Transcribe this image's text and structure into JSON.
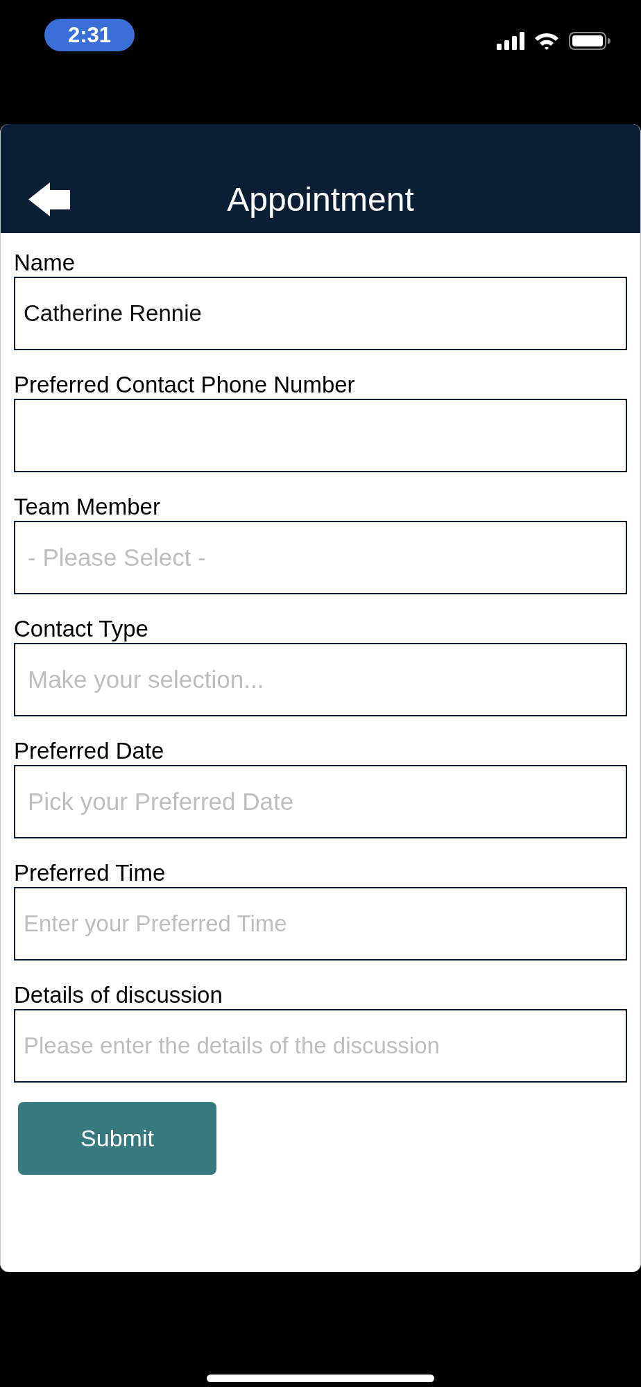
{
  "status_bar": {
    "time": "2:31"
  },
  "header": {
    "title": "Appointment"
  },
  "fields": [
    {
      "label": "Name",
      "kind": "text",
      "value": "Catherine Rennie"
    },
    {
      "label": "Preferred Contact Phone Number",
      "kind": "text"
    },
    {
      "label": "Team Member",
      "kind": "picker",
      "placeholder": "- Please Select -"
    },
    {
      "label": "Contact Type",
      "kind": "picker",
      "placeholder": "Make your selection..."
    },
    {
      "label": "Preferred Date",
      "kind": "picker",
      "placeholder": "Pick your Preferred Date"
    },
    {
      "label": "Preferred Time",
      "kind": "text",
      "placeholder": "Enter your Preferred Time"
    },
    {
      "label": "Details of discussion",
      "kind": "text",
      "placeholder": "Please enter the details of the discussion"
    }
  ],
  "submit_button": {
    "label": "Submit"
  }
}
